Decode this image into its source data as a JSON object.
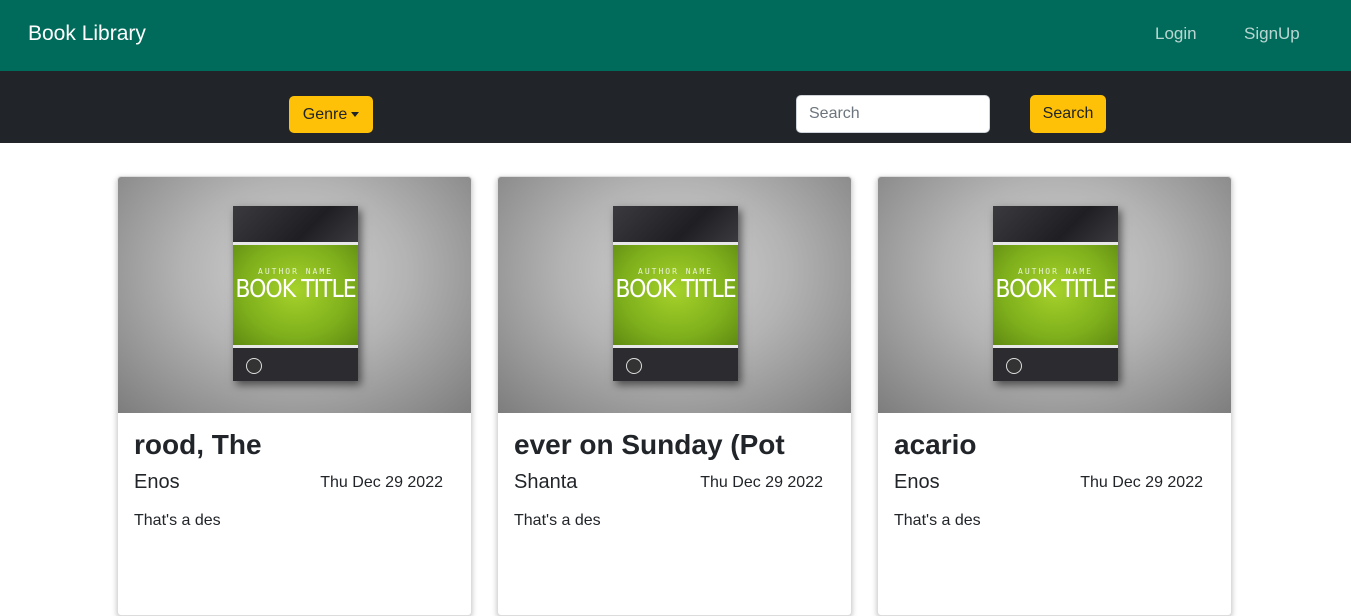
{
  "navbar": {
    "brand": "Book Library",
    "links": [
      "Login",
      "SignUp"
    ]
  },
  "filters": {
    "genre_label": "Genre",
    "search_placeholder": "Search",
    "search_value": "",
    "search_button": "Search"
  },
  "cover_art": {
    "author_text": "AUTHOR NAME",
    "title_text": "BOOK TITLE"
  },
  "books": [
    {
      "title": "rood, The",
      "author": "Enos",
      "date": "Thu Dec 29 2022",
      "description": "That's a des"
    },
    {
      "title": "ever on Sunday (Pot",
      "author": "Shanta",
      "date": "Thu Dec 29 2022",
      "description": "That's a des"
    },
    {
      "title": "acario",
      "author": "Enos",
      "date": "Thu Dec 29 2022",
      "description": "That's a des"
    }
  ],
  "colors": {
    "navbar": "#006b5b",
    "filterbar": "#212529",
    "button": "#ffc107"
  }
}
